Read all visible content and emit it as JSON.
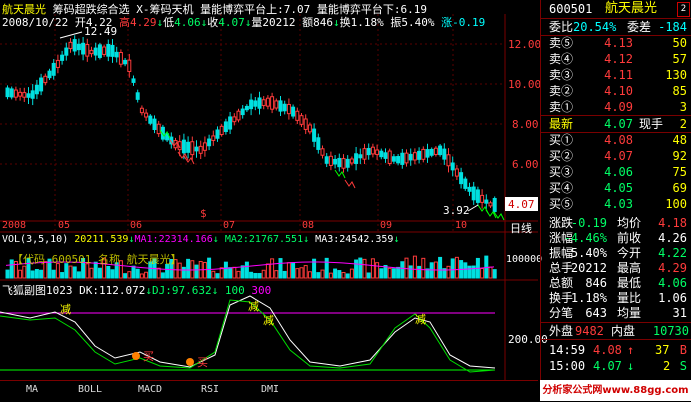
{
  "stock": {
    "name": "航天晨光",
    "code": "600501"
  },
  "header": {
    "line1_title": "航天晨光",
    "line1_text": "筹码超跌综合选 X-筹码天机 量能博弈平台上:7.07 量能博弈平台下:6.19",
    "date": "2008/10/22",
    "open_label": "开",
    "open": "4.22",
    "high_label": "高",
    "high": "4.29",
    "low_label": "低",
    "low": "4.06",
    "close_label": "收",
    "close": "4.07",
    "vol_label": "量",
    "vol": "20212",
    "amt_label": "额",
    "amt": "846",
    "turn_label": "换",
    "turn": "1.18%",
    "amp_label": "振",
    "amp": "5.40%",
    "chg_label": "涨",
    "chg": "-0.19"
  },
  "price_axis": {
    "ticks": [
      "12.00",
      "10.00",
      "8.00",
      "6.00",
      "4.07"
    ],
    "max_label": "12.49",
    "min_label": "3.92"
  },
  "time_axis": {
    "labels": [
      "2008",
      "05",
      "06",
      "07",
      "08",
      "09",
      "10"
    ],
    "period_label": "日线"
  },
  "volume": {
    "title": "VOL(3,5,10)",
    "v1": "20211.539",
    "ma1": "MA1:22314.166",
    "ma2": "MA2:21767.551",
    "ma3": "MA3:24542.359",
    "overlay": "【代码 600501 名称 航天晨光】",
    "axis": "100000"
  },
  "indicator": {
    "title": "飞狐副图1023",
    "dk": "DK:112.072",
    "dj": "DJ:97.632",
    "v1": "100",
    "v2": "300",
    "axis": "200.00",
    "mark": "减",
    "mark2": "买"
  },
  "tabs": [
    "MA",
    "BOLL",
    "MACD",
    "RSI",
    "DMI"
  ],
  "quote": {
    "wb_label": "委比",
    "wb": "20.54%",
    "wc_label": "委差",
    "wc": "-184",
    "sells": [
      {
        "k": "卖⑤",
        "p": "4.13",
        "n": "50"
      },
      {
        "k": "卖④",
        "p": "4.12",
        "n": "57"
      },
      {
        "k": "卖③",
        "p": "4.11",
        "n": "130"
      },
      {
        "k": "卖②",
        "p": "4.10",
        "n": "85"
      },
      {
        "k": "卖①",
        "p": "4.09",
        "n": "3"
      }
    ],
    "latest_label": "最新",
    "latest": "4.07",
    "hand_label": "现手",
    "hand": "2",
    "buys": [
      {
        "k": "买①",
        "p": "4.08",
        "n": "48"
      },
      {
        "k": "买②",
        "p": "4.07",
        "n": "92"
      },
      {
        "k": "买③",
        "p": "4.06",
        "n": "75"
      },
      {
        "k": "买④",
        "p": "4.05",
        "n": "69"
      },
      {
        "k": "买⑤",
        "p": "4.03",
        "n": "100"
      }
    ],
    "stats": [
      {
        "k": "涨跌",
        "v": "-0.19",
        "k2": "均价",
        "v2": "4.18"
      },
      {
        "k": "涨幅",
        "v": "-4.46%",
        "k2": "前收",
        "v2": "4.26"
      },
      {
        "k": "振幅",
        "v": "5.40%",
        "k2": "今开",
        "v2": "4.22"
      },
      {
        "k": "总手",
        "v": "20212",
        "k2": "最高",
        "v2": "4.29"
      },
      {
        "k": "总额",
        "v": "846",
        "k2": "最低",
        "v2": "4.06"
      },
      {
        "k": "换手",
        "v": "1.18%",
        "k2": "量比",
        "v2": "1.06"
      },
      {
        "k": "分笔",
        "v": "643",
        "k2": "均量",
        "v2": "31"
      }
    ],
    "outer_label": "外盘",
    "outer": "9482",
    "inner_label": "内盘",
    "inner": "10730",
    "ticks": [
      {
        "t": "14:59",
        "p": "4.08",
        "n": "37",
        "f": "B"
      },
      {
        "t": "15:00",
        "p": "4.07",
        "n": "2",
        "f": "S"
      }
    ]
  },
  "watermark": "分析家公式网www.88gg.com"
}
